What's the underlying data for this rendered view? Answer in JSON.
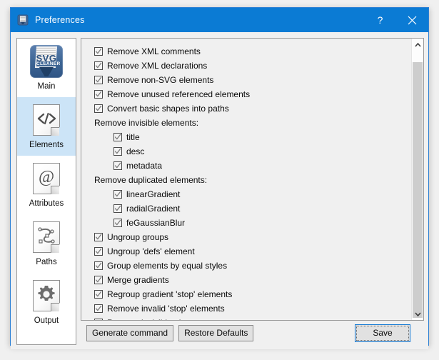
{
  "window": {
    "title": "Preferences",
    "icon": "app-icon",
    "accent_blue": "#0b7bd4",
    "border_color": "#2a7fd4",
    "help_label": "?",
    "close_label": "✕"
  },
  "sidebar": {
    "selected": "Elements",
    "highlight_color": "#cce4f7",
    "items": [
      {
        "label": "Main",
        "icon": "svg-cleaner-app-icon"
      },
      {
        "label": "Elements",
        "icon": "code-page-icon"
      },
      {
        "label": "Attributes",
        "icon": "at-sign-page-icon"
      },
      {
        "label": "Paths",
        "icon": "bezier-path-page-icon"
      },
      {
        "label": "Output",
        "icon": "gear-page-icon"
      }
    ]
  },
  "options": {
    "rows": [
      {
        "type": "checkbox",
        "label": "Remove XML comments",
        "checked": true,
        "indent": 0
      },
      {
        "type": "checkbox",
        "label": "Remove XML declarations",
        "checked": true,
        "indent": 0
      },
      {
        "type": "checkbox",
        "label": "Remove non-SVG elements",
        "checked": true,
        "indent": 0
      },
      {
        "type": "checkbox",
        "label": "Remove unused referenced elements",
        "checked": true,
        "indent": 0
      },
      {
        "type": "checkbox",
        "label": "Convert basic shapes into paths",
        "checked": true,
        "indent": 0
      },
      {
        "type": "group",
        "label": "Remove invisible elements:",
        "checked": false,
        "indent": 0
      },
      {
        "type": "checkbox",
        "label": "title",
        "checked": true,
        "indent": 1
      },
      {
        "type": "checkbox",
        "label": "desc",
        "checked": true,
        "indent": 1
      },
      {
        "type": "checkbox",
        "label": "metadata",
        "checked": true,
        "indent": 1
      },
      {
        "type": "group",
        "label": "Remove duplicated elements:",
        "checked": false,
        "indent": 0
      },
      {
        "type": "checkbox",
        "label": "linearGradient",
        "checked": true,
        "indent": 1
      },
      {
        "type": "checkbox",
        "label": "radialGradient",
        "checked": true,
        "indent": 1
      },
      {
        "type": "checkbox",
        "label": "feGaussianBlur",
        "checked": true,
        "indent": 1
      },
      {
        "type": "checkbox",
        "label": "Ungroup groups",
        "checked": true,
        "indent": 0
      },
      {
        "type": "checkbox",
        "label": "Ungroup 'defs' element",
        "checked": true,
        "indent": 0
      },
      {
        "type": "checkbox",
        "label": "Group elements by equal styles",
        "checked": true,
        "indent": 0
      },
      {
        "type": "checkbox",
        "label": "Merge gradients",
        "checked": true,
        "indent": 0
      },
      {
        "type": "checkbox",
        "label": "Regroup gradient 'stop' elements",
        "checked": true,
        "indent": 0
      },
      {
        "type": "checkbox",
        "label": "Remove invalid 'stop' elements",
        "checked": true,
        "indent": 0
      },
      {
        "type": "checkbox",
        "label": "Remove invisible elements",
        "checked": true,
        "indent": 0
      }
    ],
    "scrollbar": {
      "up_arrow": "▲",
      "down_arrow": "▼",
      "thumb_top_pct": 4,
      "thumb_height_pct": 91
    }
  },
  "footer": {
    "generate_command_label": "Generate command",
    "restore_defaults_label": "Restore Defaults",
    "save_label": "Save"
  }
}
